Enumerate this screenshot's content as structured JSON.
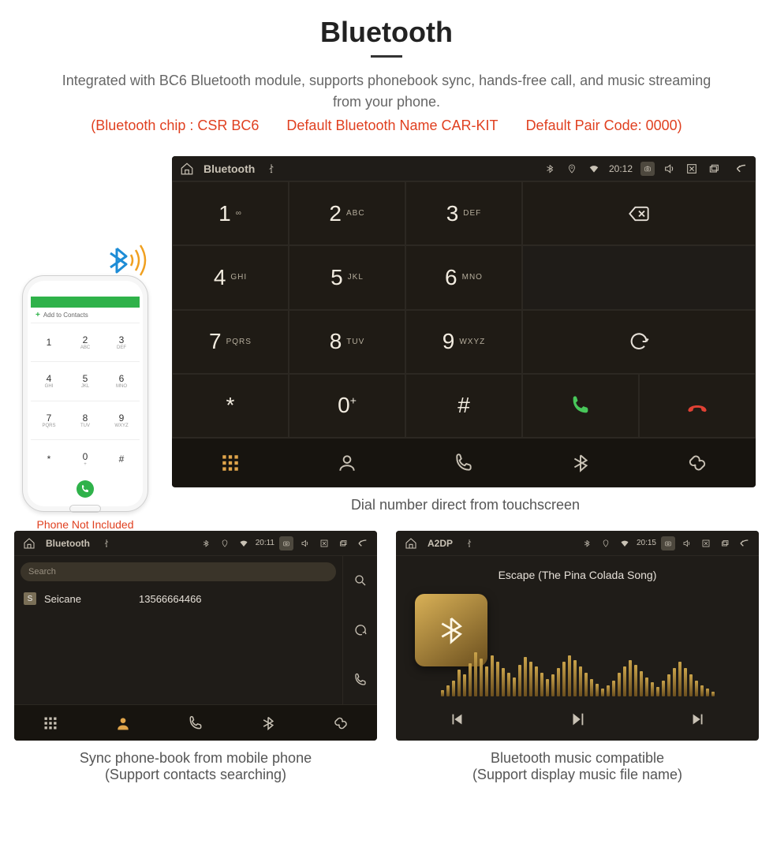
{
  "header": {
    "title": "Bluetooth",
    "description": "Integrated with BC6 Bluetooth module, supports phonebook sync, hands-free call, and music streaming from your phone.",
    "spec_chip": "(Bluetooth chip : CSR BC6",
    "spec_name": "Default Bluetooth Name CAR-KIT",
    "spec_pair": "Default Pair Code: 0000)"
  },
  "phone": {
    "add_contact": "Add to Contacts",
    "caption": "Phone Not Included",
    "keys": [
      {
        "n": "1",
        "s": ""
      },
      {
        "n": "2",
        "s": "ABC"
      },
      {
        "n": "3",
        "s": "DEF"
      },
      {
        "n": "4",
        "s": "GHI"
      },
      {
        "n": "5",
        "s": "JKL"
      },
      {
        "n": "6",
        "s": "MNO"
      },
      {
        "n": "7",
        "s": "PQRS"
      },
      {
        "n": "8",
        "s": "TUV"
      },
      {
        "n": "9",
        "s": "WXYZ"
      },
      {
        "n": "*",
        "s": ""
      },
      {
        "n": "0",
        "s": "+"
      },
      {
        "n": "#",
        "s": ""
      }
    ]
  },
  "mainUnit": {
    "title": "Bluetooth",
    "time": "20:12",
    "keys": [
      {
        "n": "1",
        "s": "∞"
      },
      {
        "n": "2",
        "s": "ABC"
      },
      {
        "n": "3",
        "s": "DEF"
      },
      {
        "n": "4",
        "s": "GHI"
      },
      {
        "n": "5",
        "s": "JKL"
      },
      {
        "n": "6",
        "s": "MNO"
      },
      {
        "n": "7",
        "s": "PQRS"
      },
      {
        "n": "8",
        "s": "TUV"
      },
      {
        "n": "9",
        "s": "WXYZ"
      },
      {
        "n": "*",
        "s": ""
      },
      {
        "n": "0",
        "s": "+",
        "sup": "+"
      },
      {
        "n": "#",
        "s": ""
      }
    ],
    "caption": "Dial number direct from touchscreen"
  },
  "phonebookUnit": {
    "title": "Bluetooth",
    "time": "20:11",
    "search_placeholder": "Search",
    "contact": {
      "initial": "S",
      "name": "Seicane",
      "number": "13566664466"
    },
    "caption1": "Sync phone-book from mobile phone",
    "caption2": "(Support contacts searching)"
  },
  "musicUnit": {
    "title": "A2DP",
    "time": "20:15",
    "song": "Escape (The Pina Colada Song)",
    "caption1": "Bluetooth music compatible",
    "caption2": "(Support display music file name)",
    "eq": [
      8,
      14,
      20,
      34,
      28,
      42,
      56,
      48,
      38,
      52,
      44,
      36,
      30,
      24,
      40,
      50,
      44,
      38,
      30,
      22,
      28,
      36,
      44,
      52,
      46,
      38,
      30,
      22,
      16,
      10,
      14,
      20,
      30,
      38,
      46,
      40,
      32,
      24,
      18,
      12,
      20,
      28,
      36,
      44,
      36,
      28,
      20,
      14,
      10,
      6
    ]
  }
}
